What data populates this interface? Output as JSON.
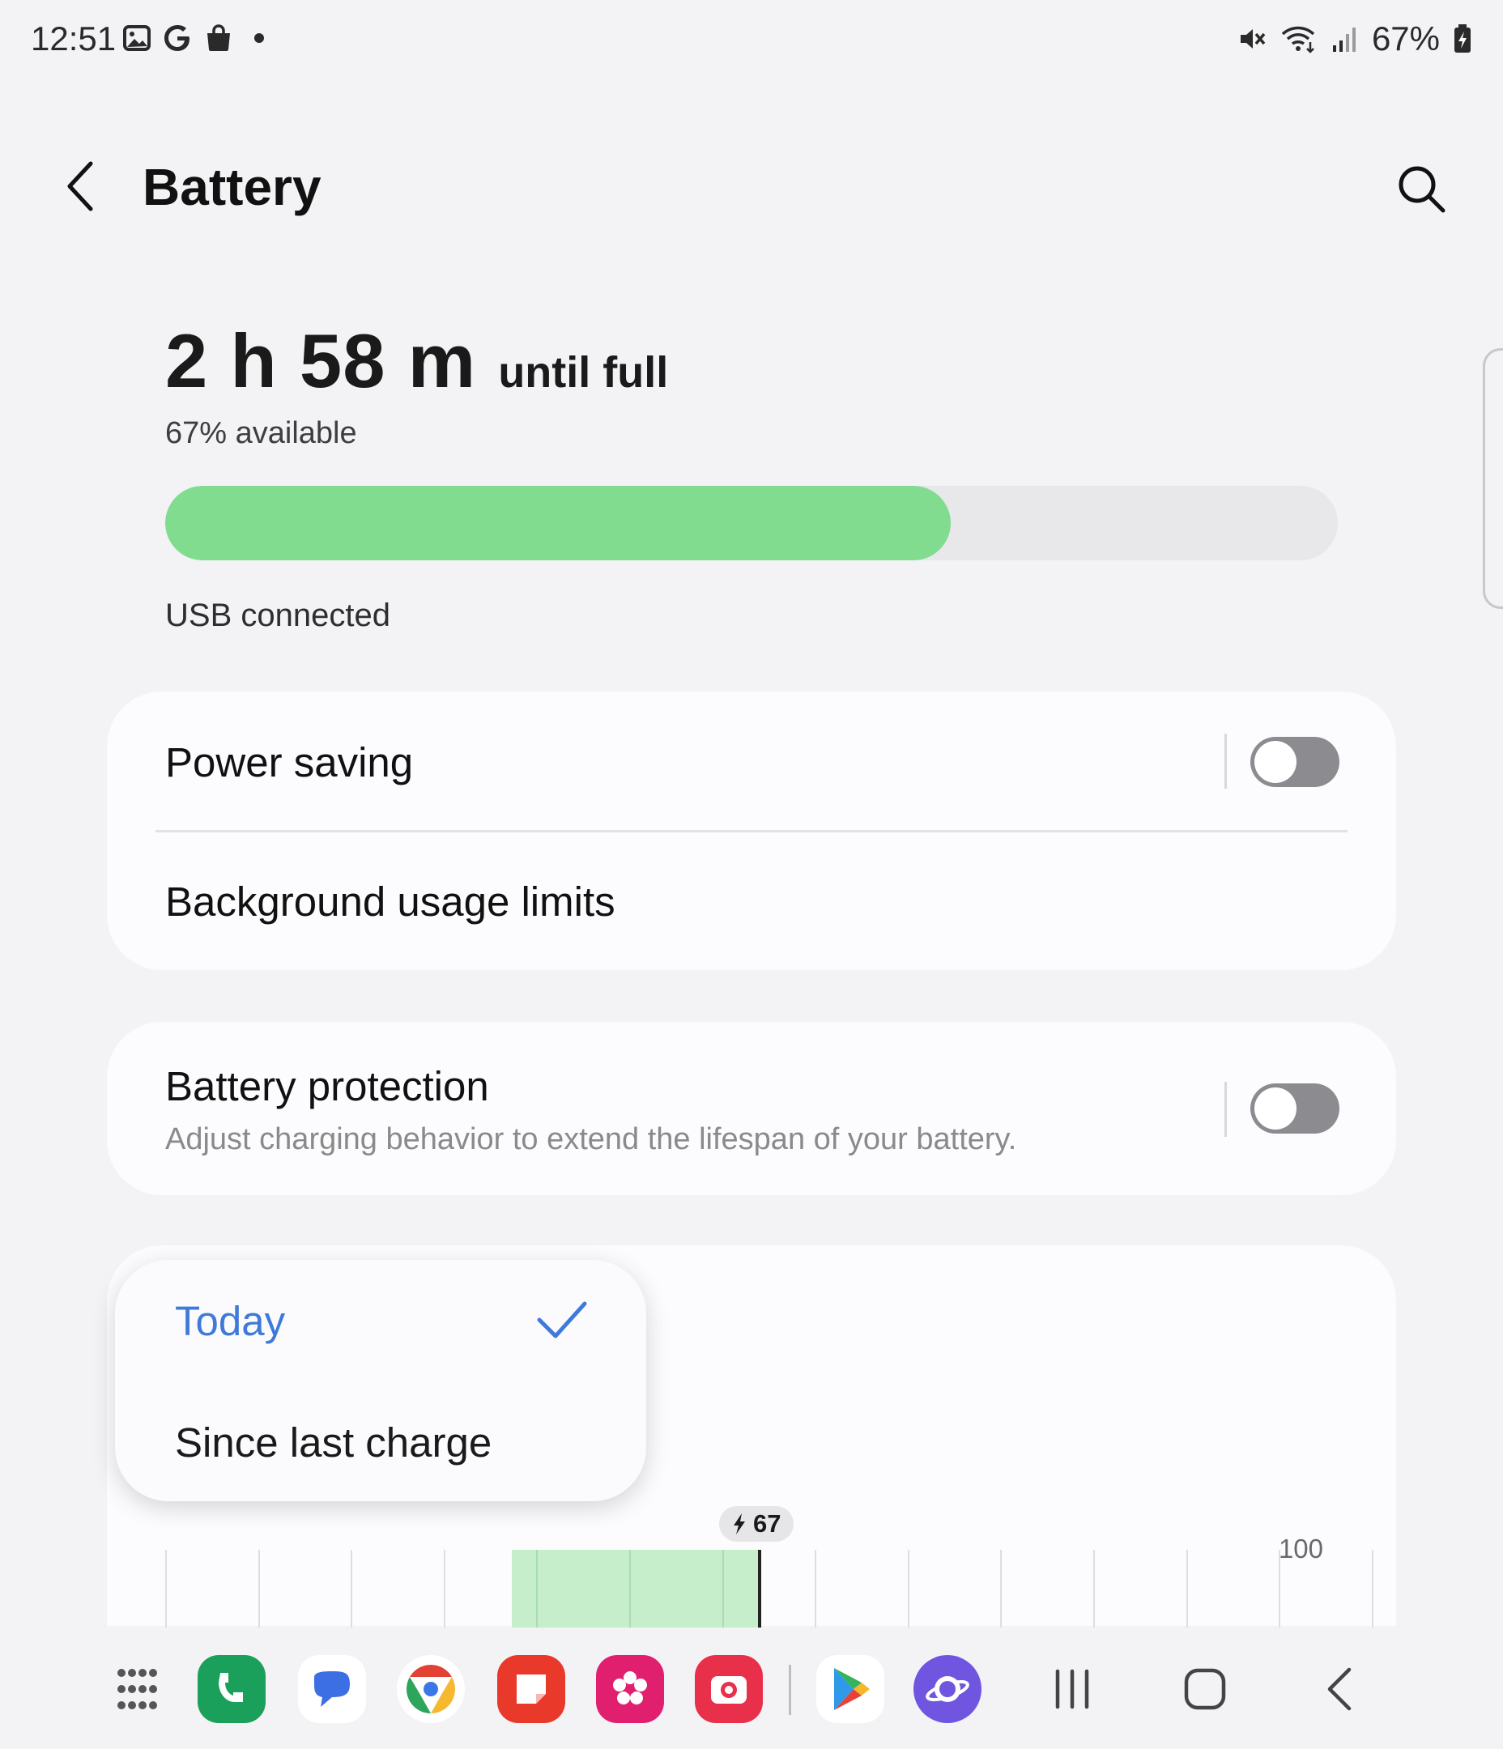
{
  "status_bar": {
    "time": "12:51",
    "battery_percent": "67%",
    "left_icons": [
      "gallery-icon",
      "google-icon",
      "shopping-bag-icon",
      "notification-dot-icon"
    ],
    "right_icons": [
      "mute-icon",
      "wifi-icon",
      "signal-icon",
      "battery-charging-icon"
    ]
  },
  "header": {
    "title": "Battery",
    "back_icon": "chevron-left-icon",
    "search_icon": "search-icon"
  },
  "summary": {
    "time_value": "2 h 58 m",
    "time_suffix": "until full",
    "available": "67% available",
    "level_percent": 67,
    "bar_color": "#82dc8f",
    "connection": "USB connected"
  },
  "settings": {
    "power_saving": {
      "label": "Power saving",
      "enabled": false
    },
    "background_limits": {
      "label": "Background usage limits"
    },
    "battery_protection": {
      "label": "Battery protection",
      "description": "Adjust charging behavior to extend the lifespan of your battery.",
      "enabled": false
    }
  },
  "dropdown": {
    "options": [
      {
        "label": "Today",
        "selected": true
      },
      {
        "label": "Since last charge",
        "selected": false
      }
    ],
    "accent": "#3f79d9"
  },
  "usage_chart": {
    "badge_value": "67",
    "badge_icon": "bolt-icon",
    "max_label": "100",
    "fill_color": "#c6eecb"
  },
  "dock": {
    "apps": [
      "app-drawer-icon",
      "phone-app-icon",
      "messages-app-icon",
      "chrome-app-icon",
      "notes-app-icon",
      "gallery-app-icon",
      "camera-app-icon",
      "play-store-app-icon",
      "internet-app-icon"
    ],
    "nav": [
      "recents-icon",
      "home-icon",
      "back-icon"
    ]
  }
}
